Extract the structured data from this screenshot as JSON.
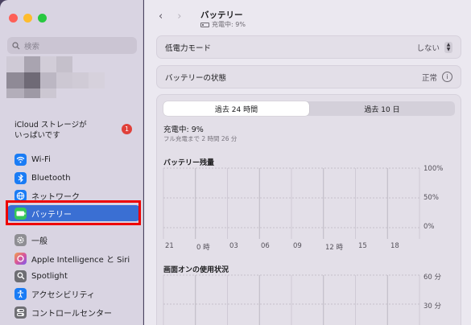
{
  "sidebar": {
    "search_placeholder": "検索",
    "icloud": {
      "line1": "iCloud ストレージが",
      "line2": "いっぱいです",
      "badge": "1"
    },
    "items": [
      {
        "label": "Wi-Fi",
        "icon": "wifi-icon",
        "color": "#1a7cf5"
      },
      {
        "label": "Bluetooth",
        "icon": "bluetooth-icon",
        "color": "#1a7cf5"
      },
      {
        "label": "ネットワーク",
        "icon": "globe-icon",
        "color": "#1a7cf5"
      },
      {
        "label": "バッテリー",
        "icon": "battery-icon",
        "color": "#34c759",
        "selected": true
      },
      {
        "label": "一般",
        "icon": "gear-icon",
        "color": "#8e8e93"
      },
      {
        "label": "Apple Intelligence と Siri",
        "icon": "siri-icon",
        "color": "#d86a9a"
      },
      {
        "label": "Spotlight",
        "icon": "spotlight-icon",
        "color": "#6e6e73"
      },
      {
        "label": "アクセシビリティ",
        "icon": "accessibility-icon",
        "color": "#1a7cf5"
      },
      {
        "label": "コントロールセンター",
        "icon": "control-center-icon",
        "color": "#6e6e73"
      }
    ]
  },
  "header": {
    "title": "バッテリー",
    "subtitle": "充電中: 9%"
  },
  "rows": {
    "low_power": {
      "label": "低電力モード",
      "value": "しない"
    },
    "health": {
      "label": "バッテリーの状態",
      "value": "正常"
    }
  },
  "panel": {
    "tabs": [
      "過去 24 時間",
      "過去 10 日"
    ],
    "active_tab": 0,
    "charging": "充電中: 9%",
    "full_charge": "フル充電まで 2 時間 26 分",
    "battery_level_title": "バッテリー残量",
    "screen_on_title": "画面オンの使用状況"
  },
  "chart_data": [
    {
      "type": "bar",
      "title": "バッテリー残量",
      "x_tick_labels": [
        "21",
        "0 時",
        "03",
        "06",
        "09",
        "12 時",
        "15",
        "18"
      ],
      "y_tick_labels": [
        "100%",
        "50%",
        "0%"
      ],
      "ylim": [
        0,
        100
      ],
      "values": [],
      "grid": true
    },
    {
      "type": "bar",
      "title": "画面オンの使用状況",
      "y_tick_labels": [
        "60 分",
        "30 分"
      ],
      "values": [],
      "grid": true
    }
  ]
}
